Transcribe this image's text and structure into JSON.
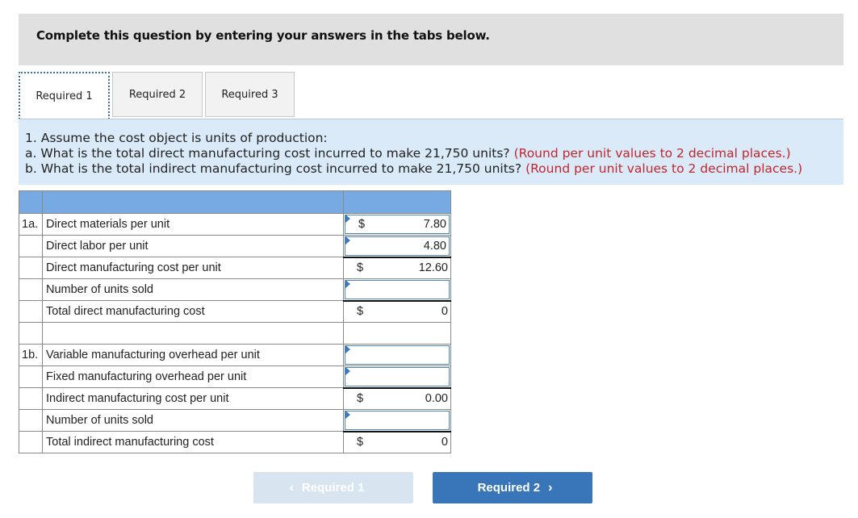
{
  "banner": {
    "text": "Complete this question by entering your answers in the tabs below."
  },
  "tabs": [
    {
      "label": "Required 1",
      "active": true
    },
    {
      "label": "Required 2",
      "active": false
    },
    {
      "label": "Required 3",
      "active": false
    }
  ],
  "question": {
    "line1": "1. Assume the cost object is units of production:",
    "line2_text": "a. What is the total direct manufacturing cost incurred to make 21,750 units?",
    "line2_note": "(Round per unit values to 2 decimal places.)",
    "line3_text": "b. What is the total indirect manufacturing cost incurred to make 21,750 units?",
    "line3_note": "(Round per unit values to 2 decimal places.)"
  },
  "worksheet": {
    "rows": [
      {
        "num": "1a.",
        "label": "Direct materials per unit",
        "dollar": "$",
        "value": "7.80",
        "input": true
      },
      {
        "num": "",
        "label": "Direct labor per unit",
        "dollar": "",
        "value": "4.80",
        "input": true
      },
      {
        "num": "",
        "label": "Direct manufacturing cost per unit",
        "dollar": "$",
        "value": "12.60",
        "input": false
      },
      {
        "num": "",
        "label": "Number of units sold",
        "dollar": "",
        "value": "",
        "input": true
      },
      {
        "num": "",
        "label": "Total direct manufacturing cost",
        "dollar": "$",
        "value": "0",
        "input": false
      },
      {
        "num": "",
        "label": "",
        "dollar": "",
        "value": "",
        "input": false
      },
      {
        "num": "1b.",
        "label": "Variable manufacturing overhead per unit",
        "dollar": "",
        "value": "",
        "input": true
      },
      {
        "num": "",
        "label": "Fixed manufacturing overhead per unit",
        "dollar": "",
        "value": "",
        "input": true
      },
      {
        "num": "",
        "label": "Indirect manufacturing cost per unit",
        "dollar": "$",
        "value": "0.00",
        "input": false
      },
      {
        "num": "",
        "label": "Number of units sold",
        "dollar": "",
        "value": "",
        "input": true
      },
      {
        "num": "",
        "label": "Total indirect manufacturing cost",
        "dollar": "$",
        "value": "0",
        "input": false
      }
    ]
  },
  "nav": {
    "prev_label": "Required 1",
    "next_label": "Required 2",
    "prev_icon": "chevron-left-icon",
    "next_icon": "chevron-right-icon"
  },
  "colors": {
    "header_row": "#77aae3",
    "question_bg": "#daeaf8",
    "note_red": "#c0272d",
    "next_button": "#3975b9",
    "prev_button_disabled": "#d9e4f1"
  }
}
